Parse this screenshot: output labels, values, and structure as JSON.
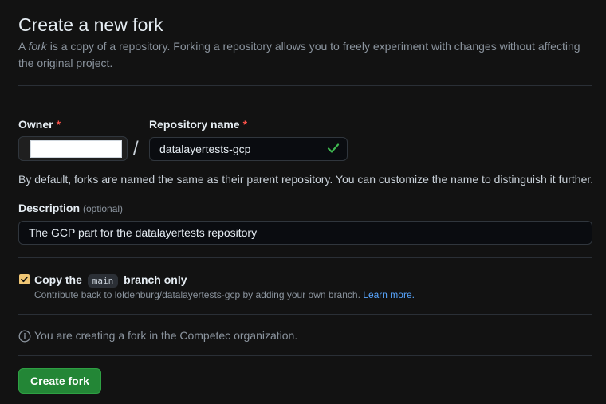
{
  "page": {
    "title": "Create a new fork",
    "subtitle_prefix": "A ",
    "subtitle_em": "fork",
    "subtitle_rest": " is a copy of a repository. Forking a repository allows you to freely experiment with changes without affecting the original project."
  },
  "owner": {
    "label": "Owner",
    "required_mark": "*"
  },
  "repository": {
    "label": "Repository name",
    "required_mark": "*",
    "value": "datalayertests-gcp",
    "valid_icon": "check-icon",
    "hint": "By default, forks are named the same as their parent repository. You can customize the name to distinguish it further."
  },
  "description": {
    "label": "Description",
    "optional": "(optional)",
    "value": "The GCP part for the datalayertests repository"
  },
  "copy_branch": {
    "checked": true,
    "label_prefix": "Copy the",
    "branch": "main",
    "label_suffix": "branch only",
    "note": "Contribute back to loldenburg/datalayertests-gcp by adding your own branch.",
    "link": "Learn more."
  },
  "info": {
    "icon": "info-icon",
    "text": "You are creating a fork in the Competec organization."
  },
  "actions": {
    "create_label": "Create fork"
  },
  "colors": {
    "background": "#121212",
    "primary_button": "#238636",
    "required": "#f85149",
    "valid_check": "#3fb950",
    "checkbox": "#f0c674",
    "link": "#58a6ff"
  }
}
